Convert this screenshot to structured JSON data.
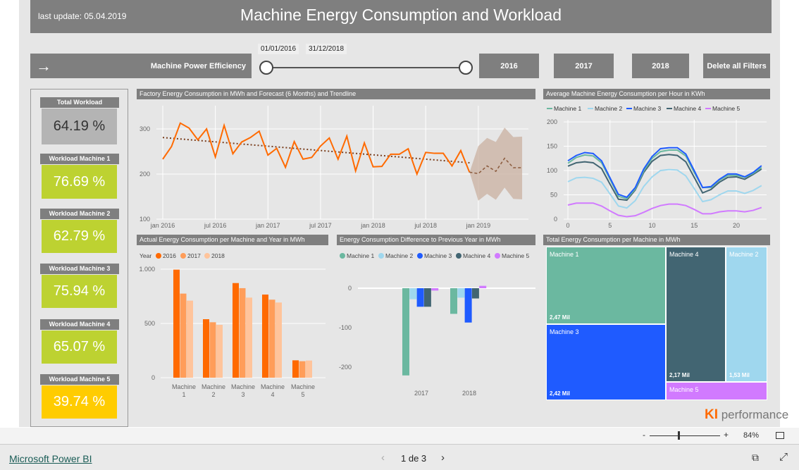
{
  "header": {
    "last_update": "last update: 05.04.2019",
    "title": "Machine Energy Consumption and Workload"
  },
  "filters": {
    "date_start": "01/01/2016",
    "date_end": "31/12/2018",
    "slider_range": [
      0,
      1
    ],
    "nav_label": "Machine Power Efficiency",
    "year_buttons": [
      "2016",
      "2017",
      "2018"
    ],
    "delete_label": "Delete all Filters"
  },
  "kpis": [
    {
      "label": "Total Workload",
      "value": "64.19 %",
      "color": "#b4b4b4"
    },
    {
      "label": "Workload Machine 1",
      "value": "76.69 %",
      "color": "#bdd231"
    },
    {
      "label": "Workload Machine 2",
      "value": "62.79 %",
      "color": "#bdd231"
    },
    {
      "label": "Workload Machine 3",
      "value": "75.94 %",
      "color": "#bdd231"
    },
    {
      "label": "Workload Machine 4",
      "value": "65.07 %",
      "color": "#bdd231"
    },
    {
      "label": "Workload Machine 5",
      "value": "39.74 %",
      "color": "#ffcc00"
    }
  ],
  "chart_data": [
    {
      "type": "line",
      "title": "Factory Energy Consumption in MWh and Forecast (6 Months) and Trendline",
      "x_ticks": [
        "jan 2016",
        "jul 2016",
        "jan 2017",
        "jul 2017",
        "jan 2018",
        "jul 2018",
        "jan 2019"
      ],
      "y_ticks": [
        "100",
        "200",
        "300"
      ],
      "ylim": [
        100,
        340
      ],
      "grid": true,
      "actual": [
        233,
        261,
        313,
        302,
        276,
        300,
        238,
        308,
        245,
        271,
        281,
        295,
        242,
        257,
        215,
        272,
        233,
        237,
        262,
        280,
        233,
        284,
        207,
        269,
        216,
        217,
        244,
        244,
        256,
        200,
        248,
        246,
        246,
        218,
        252,
        204
      ],
      "forecast": [
        201,
        218,
        206,
        235,
        214,
        214
      ],
      "forecast_upper": [
        262,
        280,
        271,
        303,
        282,
        283
      ],
      "forecast_lower": [
        141,
        156,
        143,
        170,
        145,
        144
      ],
      "trend": [
        281,
        225
      ],
      "color": "#ff6a00"
    },
    {
      "type": "line",
      "title": "Average Machine Energy Consumption per Hour in KWh",
      "x_ticks": [
        "0",
        "5",
        "10",
        "15",
        "20"
      ],
      "y_ticks": [
        "0",
        "50",
        "100",
        "150",
        "200"
      ],
      "ylim": [
        0,
        200
      ],
      "legend": "top-left",
      "series": [
        {
          "name": "Machine 1",
          "color": "#6bb8a0",
          "values": [
            115,
            127,
            132,
            130,
            116,
            82,
            47,
            42,
            62,
            99,
            125,
            139,
            142,
            142,
            130,
            96,
            65,
            65,
            80,
            90,
            90,
            86,
            94,
            106
          ]
        },
        {
          "name": "Machine 2",
          "color": "#9fd7ee",
          "values": [
            77,
            85,
            86,
            84,
            76,
            52,
            27,
            23,
            38,
            67,
            87,
            100,
            102,
            101,
            89,
            63,
            36,
            40,
            50,
            58,
            58,
            53,
            59,
            69
          ]
        },
        {
          "name": "Machine 3",
          "color": "#1f5bff",
          "values": [
            120,
            131,
            137,
            135,
            120,
            85,
            51,
            45,
            65,
            103,
            129,
            145,
            147,
            147,
            134,
            100,
            65,
            67,
            82,
            93,
            93,
            87,
            96,
            110
          ]
        },
        {
          "name": "Machine 4",
          "color": "#426572",
          "values": [
            109,
            116,
            118,
            116,
            104,
            72,
            41,
            39,
            60,
            96,
            119,
            131,
            133,
            131,
            118,
            86,
            54,
            61,
            76,
            86,
            87,
            82,
            92,
            103
          ]
        },
        {
          "name": "Machine 5",
          "color": "#d17aff",
          "values": [
            29,
            33,
            33,
            33,
            27,
            17,
            8,
            5,
            7,
            14,
            22,
            28,
            31,
            31,
            28,
            20,
            11,
            11,
            15,
            17,
            17,
            15,
            18,
            24
          ]
        }
      ]
    },
    {
      "type": "bar",
      "title": "Actual Energy Consumption per Machine and Year in MWh",
      "legend_title": "Year",
      "categories": [
        "Machine 1",
        "Machine 2",
        "Machine 3",
        "Machine 4",
        "Machine 5"
      ],
      "y_ticks": [
        "0",
        "500",
        "1.000"
      ],
      "ylim": [
        0,
        1000
      ],
      "series": [
        {
          "name": "2016",
          "color": "#ff6a00",
          "values": [
            996,
            539,
            872,
            766,
            160
          ]
        },
        {
          "name": "2017",
          "color": "#ff9d59",
          "values": [
            775,
            511,
            825,
            719,
            152
          ]
        },
        {
          "name": "2018",
          "color": "#ffc49b",
          "values": [
            710,
            487,
            738,
            693,
            158
          ]
        }
      ]
    },
    {
      "type": "bar",
      "title": "Energy Consumption Difference to Previous Year in MWh",
      "categories": [
        "2017",
        "2018"
      ],
      "y_ticks": [
        "-200",
        "-100",
        "0"
      ],
      "ylim": [
        -230,
        20
      ],
      "series": [
        {
          "name": "Machine 1",
          "color": "#6bb8a0",
          "values": [
            -221,
            -65
          ]
        },
        {
          "name": "Machine 2",
          "color": "#9fd7ee",
          "values": [
            -28,
            -24
          ]
        },
        {
          "name": "Machine 3",
          "color": "#1f5bff",
          "values": [
            -47,
            -87
          ]
        },
        {
          "name": "Machine 4",
          "color": "#426572",
          "values": [
            -47,
            -26
          ]
        },
        {
          "name": "Machine 5",
          "color": "#d17aff",
          "values": [
            -6,
            6
          ]
        }
      ]
    },
    {
      "type": "treemap",
      "title": "Total Energy Consumption per Machine in MWh",
      "items": [
        {
          "name": "Machine 1",
          "label": "2,47 Mil",
          "color": "#6bb8a0"
        },
        {
          "name": "Machine 3",
          "label": "2,42 Mil",
          "color": "#1f5bff"
        },
        {
          "name": "Machine 4",
          "label": "2,17 Mil",
          "color": "#426572"
        },
        {
          "name": "Machine 2",
          "label": "1,53 Mil",
          "color": "#9fd7ee"
        },
        {
          "name": "Machine 5",
          "label": "",
          "color": "#d17aff"
        }
      ]
    }
  ],
  "logo": {
    "brand": "KI",
    "text": "performance"
  },
  "zoom": {
    "minus": "-",
    "plus": "+",
    "level": "84%"
  },
  "footer": {
    "link": "Microsoft Power BI",
    "page": "1 de 3"
  }
}
